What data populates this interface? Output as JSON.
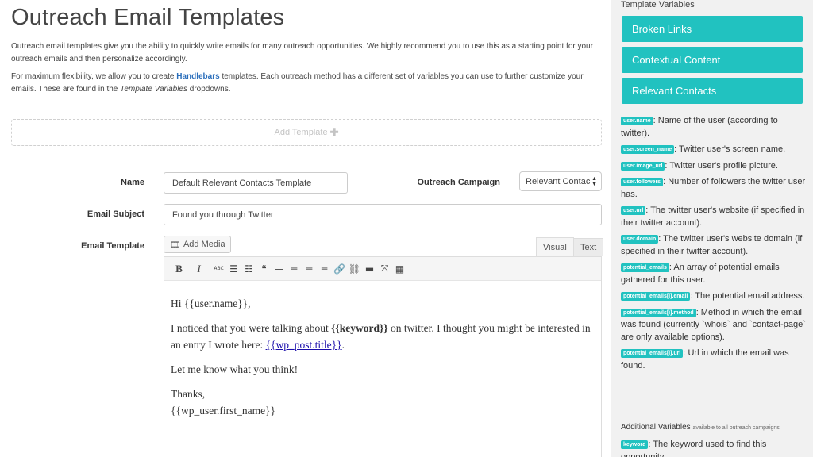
{
  "page": {
    "title": "Outreach Email Templates",
    "intro1": "Outreach email templates give you the ability to quickly write emails for many outreach opportunities. We highly recommend you to use this as a starting point for your outreach emails and then personalize accordingly.",
    "intro2_before": "For maximum flexibility, we allow you to create ",
    "intro2_link": "Handlebars",
    "intro2_mid": " templates. Each outreach method has a different set of variables you can use to further customize your emails. These are found in the ",
    "intro2_em": "Template Variables",
    "intro2_after": " dropdowns."
  },
  "add_template": {
    "label": "Add Template",
    "icon": "plus-icon"
  },
  "form": {
    "name_label": "Name",
    "name_value": "Default Relevant Contacts Template",
    "campaign_label": "Outreach Campaign",
    "campaign_value": "Relevant Contac",
    "subject_label": "Email Subject",
    "subject_value": "Found you through Twitter",
    "template_label": "Email Template",
    "add_media": "Add Media",
    "tab_visual": "Visual",
    "tab_text": "Text"
  },
  "toolbar": [
    {
      "name": "bold-icon",
      "glyph": "B"
    },
    {
      "name": "italic-icon",
      "glyph": "I"
    },
    {
      "name": "strikethrough-icon",
      "glyph": "ABC"
    },
    {
      "name": "bullet-list-icon",
      "glyph": "☰"
    },
    {
      "name": "numbered-list-icon",
      "glyph": "☷"
    },
    {
      "name": "blockquote-icon",
      "glyph": "❝"
    },
    {
      "name": "horizontal-rule-icon",
      "glyph": "—"
    },
    {
      "name": "align-left-icon",
      "glyph": "≡"
    },
    {
      "name": "align-center-icon",
      "glyph": "≡"
    },
    {
      "name": "align-right-icon",
      "glyph": "≡"
    },
    {
      "name": "link-icon",
      "glyph": "🔗"
    },
    {
      "name": "unlink-icon",
      "glyph": "⛓"
    },
    {
      "name": "read-more-icon",
      "glyph": "▬"
    },
    {
      "name": "fullscreen-icon",
      "glyph": "⤧"
    },
    {
      "name": "toolbar-toggle-icon",
      "glyph": "▦"
    }
  ],
  "email": {
    "greeting": "Hi {{user.name}},",
    "p1_before": "I noticed that you were talking about ",
    "p1_bold": "{{keyword}}",
    "p1_mid": " on twitter. I thought you might be interested in an entry I wrote here: ",
    "p1_link": "{{wp_post.title}}",
    "p1_after": ".",
    "p2": "Let me know what you think!",
    "sign1": "Thanks,",
    "sign2": "{{wp_user.first_name}}"
  },
  "sidebar": {
    "title": "Template Variables",
    "buttons": [
      "Broken Links",
      "Contextual Content",
      "Relevant Contacts"
    ],
    "variables": [
      {
        "tag": "user.name",
        "desc": ": Name of the user (according to twitter)."
      },
      {
        "tag": "user.screen_name",
        "desc": ": Twitter user's screen name."
      },
      {
        "tag": "user.image_url",
        "desc": ": Twitter user's profile picture."
      },
      {
        "tag": "user.followers",
        "desc": ": Number of followers the twitter user has."
      },
      {
        "tag": "user.url",
        "desc": ": The twitter user's website (if specified in their twitter account)."
      },
      {
        "tag": "user.domain",
        "desc": ": The twitter user's website domain (if specified in their twitter account)."
      },
      {
        "tag": "potential_emails",
        "desc": ": An array of potential emails gathered for this user."
      },
      {
        "tag": "potential_emails[i].email",
        "desc": ": The potential email address."
      },
      {
        "tag": "potential_emails[i].method",
        "desc": ": Method in which the email was found (currently `whois` and `contact-page` are only available options)."
      },
      {
        "tag": "potential_emails[i].url",
        "desc": ": Url in which the email was found."
      }
    ],
    "additional_label": "Additional Variables",
    "additional_note": "available to all outreach campaigns",
    "keyword_tag": "keyword",
    "keyword_desc": ": The keyword used to find this opportunity."
  },
  "colors": {
    "accent": "#21c2c0",
    "link": "#2a6ebb"
  }
}
